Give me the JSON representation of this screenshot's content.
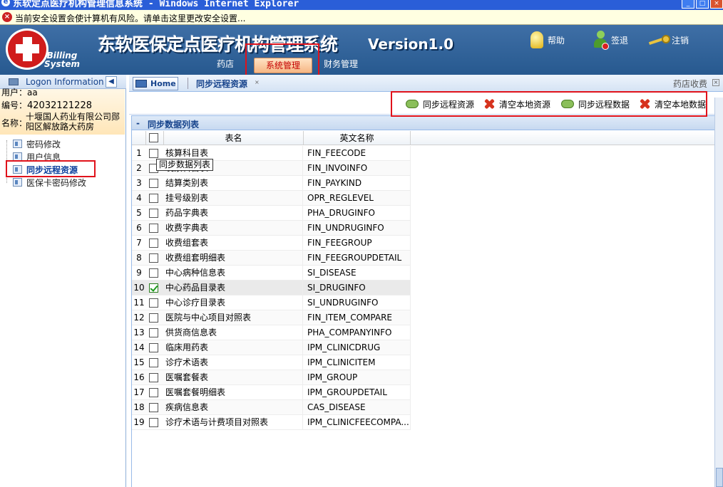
{
  "window": {
    "title": "东软定点医疗机构管理信息系统 - Windows Internet Explorer"
  },
  "infobar": {
    "message": "当前安全设置会使计算机有风险。请单击这里更改安全设置..."
  },
  "banner": {
    "logo_text_1": "Billing",
    "logo_text_2": "System",
    "system_name": "东软医保定点医疗机构管理系统",
    "version": "Version1.0"
  },
  "top_actions": {
    "help": "帮助",
    "signout": "签退",
    "logout": "注销"
  },
  "menu": {
    "tabs": [
      "药店",
      "系统管理",
      "财务管理"
    ],
    "active": "系统管理"
  },
  "sidebar": {
    "header": "Logon Information",
    "user_label": "用户：",
    "user_value": "aa",
    "code_label": "编号：",
    "code_value": "42032121228",
    "name_label": "名称：",
    "name_line1": "十堰国人药业有限公司郧",
    "name_line2": "阳区解放路大药房",
    "items": [
      "密码修改",
      "用户信息",
      "同步远程资源",
      "医保卡密码修改"
    ],
    "active_item": "同步远程资源"
  },
  "tabs": {
    "home": "Home",
    "current": "同步远程资源",
    "right_label": "药店收费"
  },
  "toolbar": {
    "sync_resource": "同步远程资源",
    "clear_resource": "清空本地资源",
    "sync_data": "同步远程数据",
    "clear_data": "清空本地数据"
  },
  "grid": {
    "title": "同步数据列表",
    "columns": [
      "表名",
      "英文名称"
    ],
    "tooltip": "同步数据列表",
    "rows": [
      {
        "num": "1",
        "cn": "核算科目表",
        "en": "FIN_FEECODE",
        "checked": false
      },
      {
        "num": "2",
        "cn": "发票科目表",
        "en": "FIN_INVOINFO",
        "checked": false
      },
      {
        "num": "3",
        "cn": "结算类别表",
        "en": "FIN_PAYKIND",
        "checked": false
      },
      {
        "num": "4",
        "cn": "挂号级别表",
        "en": "OPR_REGLEVEL",
        "checked": false
      },
      {
        "num": "5",
        "cn": "药品字典表",
        "en": "PHA_DRUGINFO",
        "checked": false
      },
      {
        "num": "6",
        "cn": "收费字典表",
        "en": "FIN_UNDRUGINFO",
        "checked": false
      },
      {
        "num": "7",
        "cn": "收费组套表",
        "en": "FIN_FEEGROUP",
        "checked": false
      },
      {
        "num": "8",
        "cn": "收费组套明细表",
        "en": "FIN_FEEGROUPDETAIL",
        "checked": false
      },
      {
        "num": "9",
        "cn": "中心病种信息表",
        "en": "SI_DISEASE",
        "checked": false
      },
      {
        "num": "10",
        "cn": "中心药品目录表",
        "en": "SI_DRUGINFO",
        "checked": true
      },
      {
        "num": "11",
        "cn": "中心诊疗目录表",
        "en": "SI_UNDRUGINFO",
        "checked": false
      },
      {
        "num": "12",
        "cn": "医院与中心项目对照表",
        "en": "FIN_ITEM_COMPARE",
        "checked": false
      },
      {
        "num": "13",
        "cn": "供货商信息表",
        "en": "PHA_COMPANYINFO",
        "checked": false
      },
      {
        "num": "14",
        "cn": "临床用药表",
        "en": "IPM_CLINICDRUG",
        "checked": false
      },
      {
        "num": "15",
        "cn": "诊疗术语表",
        "en": "IPM_CLINICITEM",
        "checked": false
      },
      {
        "num": "16",
        "cn": "医嘱套餐表",
        "en": "IPM_GROUP",
        "checked": false
      },
      {
        "num": "17",
        "cn": "医嘱套餐明细表",
        "en": "IPM_GROUPDETAIL",
        "checked": false
      },
      {
        "num": "18",
        "cn": "疾病信息表",
        "en": "CAS_DISEASE",
        "checked": false
      },
      {
        "num": "19",
        "cn": "诊疗术语与计费项目对照表",
        "en": "IPM_CLINICFEECOMPA...",
        "checked": false
      }
    ]
  }
}
